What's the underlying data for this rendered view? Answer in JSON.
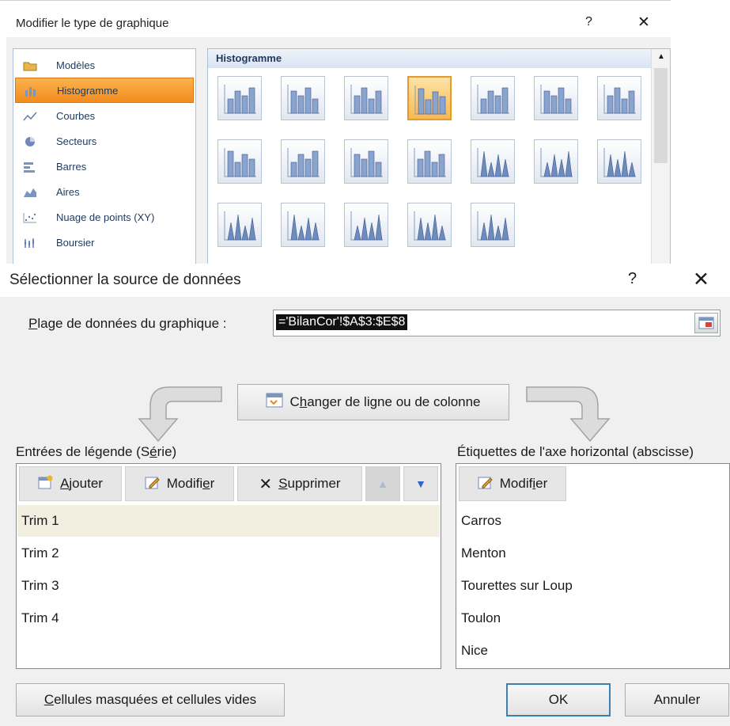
{
  "dialog_chart_type": {
    "title": "Modifier le type de graphique",
    "help_label": "?",
    "close_label": "✕",
    "categories": [
      {
        "label": "Modèles",
        "icon": "folder-icon"
      },
      {
        "label": "Histogramme",
        "icon": "column-chart-icon",
        "selected": true
      },
      {
        "label": "Courbes",
        "icon": "line-chart-icon"
      },
      {
        "label": "Secteurs",
        "icon": "pie-chart-icon"
      },
      {
        "label": "Barres",
        "icon": "bar-chart-icon"
      },
      {
        "label": "Aires",
        "icon": "area-chart-icon"
      },
      {
        "label": "Nuage de points (XY)",
        "icon": "scatter-chart-icon"
      },
      {
        "label": "Boursier",
        "icon": "stock-chart-icon"
      }
    ],
    "gallery_heading": "Histogramme",
    "selected_tile_index": 3,
    "tile_count": 19,
    "accent_color": "#f28b1e"
  },
  "dialog_data_source": {
    "title": "Sélectionner la source de données",
    "help_label": "?",
    "close_label": "✕",
    "range_label_first": "P",
    "range_label_rest": "lage de données du graphique :",
    "range_value": "='BilanCor'!$A$3:$E$8",
    "switch_button_pre": "C",
    "switch_button_u": "h",
    "switch_button_post": "anger de ligne ou de colonne",
    "legend_heading_pre": "Entrées de légende (S",
    "legend_heading_u": "é",
    "legend_heading_post": "rie)",
    "axis_heading": "Étiquettes de l'axe horizontal (abscisse)",
    "legend_toolbar": {
      "add_u": "A",
      "add_rest": "jouter",
      "edit_pre": "Modifi",
      "edit_u": "e",
      "edit_post": "r",
      "delete_u": "S",
      "delete_rest": "upprimer"
    },
    "axis_toolbar": {
      "edit_pre": "Modif",
      "edit_u": "i",
      "edit_post": "er"
    },
    "series": [
      "Trim 1",
      "Trim 2",
      "Trim 3",
      "Trim 4"
    ],
    "axis_labels": [
      "Carros",
      "Menton",
      "Tourettes sur Loup",
      "Toulon",
      "Nice"
    ],
    "hidden_cells_pre": "",
    "hidden_cells_u": "C",
    "hidden_cells_post": "ellules masquées et cellules vides",
    "ok_label": "OK",
    "cancel_label": "Annuler"
  }
}
